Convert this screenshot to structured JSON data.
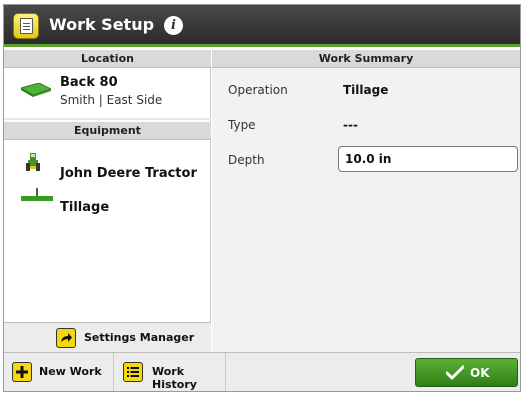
{
  "window": {
    "title": "Work Setup",
    "info_icon": "info-icon",
    "app_icon": "work-setup-icon"
  },
  "left": {
    "location_header": "Location",
    "location": {
      "name": "Back 80",
      "subtitle": "Smith | East Side",
      "icon": "field-icon"
    },
    "equipment_header": "Equipment",
    "equipment": [
      {
        "label": "John Deere Tractor",
        "icon": "tractor-icon"
      },
      {
        "label": "Tillage",
        "icon": "tillage-implement-icon"
      }
    ],
    "settings_button": {
      "label": "Settings Manager",
      "icon": "arrow-icon"
    }
  },
  "summary": {
    "header": "Work Summary",
    "operation_label": "Operation",
    "operation_value": "Tillage",
    "type_label": "Type",
    "type_value": "---",
    "depth_label": "Depth",
    "depth_value": "10.0 in"
  },
  "toolbar": {
    "new_work_label": "New Work",
    "new_work_icon": "plus-icon",
    "work_history_label": "Work History",
    "work_history_icon": "list-icon",
    "ok_label": "OK",
    "ok_icon": "checkmark-icon"
  },
  "colors": {
    "accent": "#5aa02c",
    "button_yellow": "#f5d90a",
    "title_bar": "#2b2b2b"
  }
}
